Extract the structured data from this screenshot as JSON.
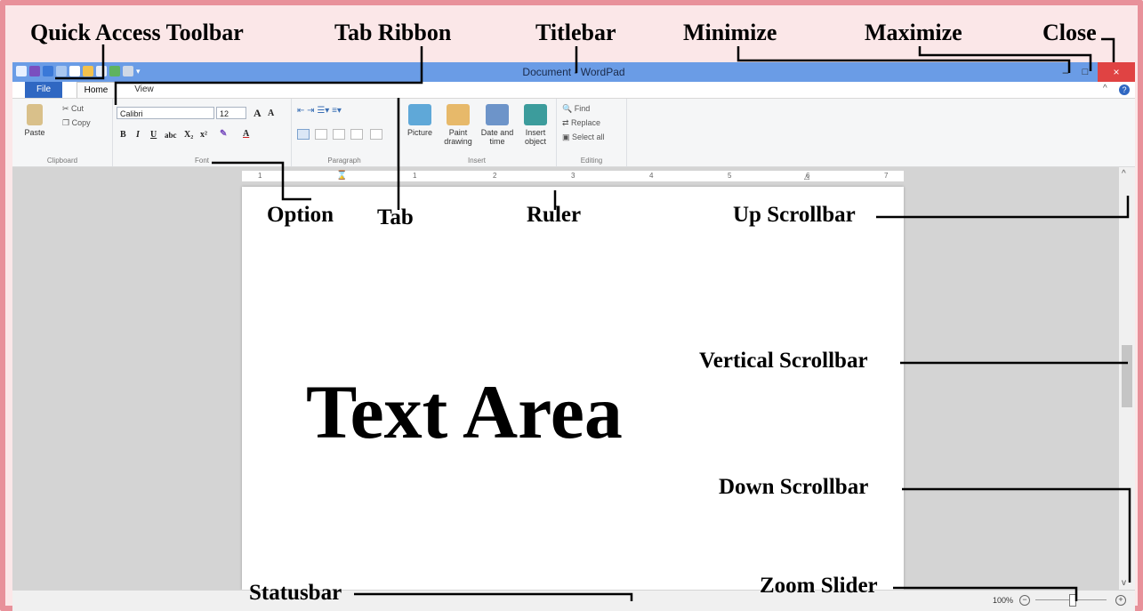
{
  "window": {
    "title": "Document - WordPad",
    "minimize_glyph": "–",
    "maximize_glyph": "□",
    "close_glyph": "×",
    "colors": {
      "titlebar": "#6a9ce6",
      "close": "#e04343",
      "frame": "#e8919a",
      "file_tab": "#2f67c2"
    }
  },
  "tabs": {
    "file": "File",
    "home": "Home",
    "view": "View"
  },
  "ribbon": {
    "clipboard": {
      "label": "Clipboard",
      "paste": "Paste",
      "cut": "Cut",
      "copy": "Copy"
    },
    "font": {
      "label": "Font",
      "family": "Calibri",
      "size": "12",
      "bold": "B",
      "italic": "I",
      "underline": "U",
      "strike": "abc",
      "subscript": "X₂",
      "superscript": "x²",
      "grow": "A",
      "shrink": "A",
      "highlight": "✎",
      "color": "A"
    },
    "paragraph": {
      "label": "Paragraph"
    },
    "insert": {
      "label": "Insert",
      "picture": "Picture",
      "paint_line1": "Paint",
      "paint_line2": "drawing",
      "datetime_line1": "Date and",
      "datetime_line2": "time",
      "object_line1": "Insert",
      "object_line2": "object"
    },
    "editing": {
      "label": "Editing",
      "find": "Find",
      "replace": "Replace",
      "select_all": "Select all"
    }
  },
  "ruler": {
    "marks": [
      "1",
      "1",
      "2",
      "3",
      "4",
      "5",
      "6",
      "7"
    ]
  },
  "statusbar": {
    "zoom": "100%",
    "zoom_minus": "−",
    "zoom_plus": "+"
  },
  "annotations": {
    "quick_access_toolbar": "Quick Access Toolbar",
    "tab_ribbon": "Tab Ribbon",
    "titlebar": "Titlebar",
    "minimize": "Minimize",
    "maximize": "Maximize",
    "close": "Close",
    "option": "Option",
    "tab": "Tab",
    "ruler": "Ruler",
    "up_scrollbar": "Up Scrollbar",
    "vertical_scrollbar": "Vertical Scrollbar",
    "text_area": "Text Area",
    "down_scrollbar": "Down Scrollbar",
    "zoom_slider": "Zoom Slider",
    "statusbar": "Statusbar"
  }
}
